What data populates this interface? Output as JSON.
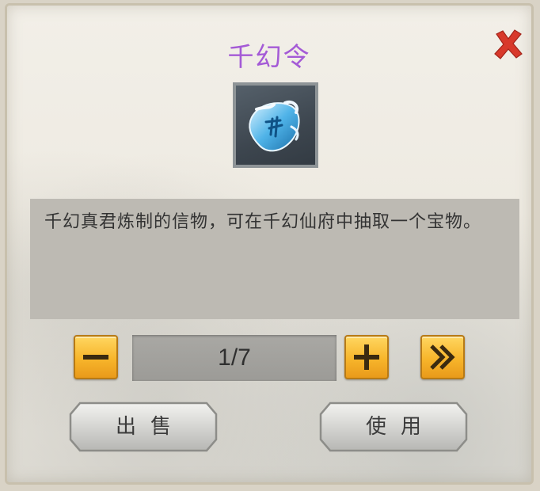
{
  "dialog": {
    "title": "千幻令",
    "description": "千幻真君炼制的信物，可在千幻仙府中抽取一个宝物。",
    "item_icon": "qianhuan-token-icon",
    "close_icon": "close-x-icon"
  },
  "quantity": {
    "display": "1/7",
    "current": 1,
    "max": 7
  },
  "actions": {
    "sell_label": "出售",
    "use_label": "使用"
  },
  "colors": {
    "title": "#a45ad6",
    "close": "#d8392b",
    "stepper_button": "#f7b52b",
    "description_bg": "#bdbab3"
  }
}
